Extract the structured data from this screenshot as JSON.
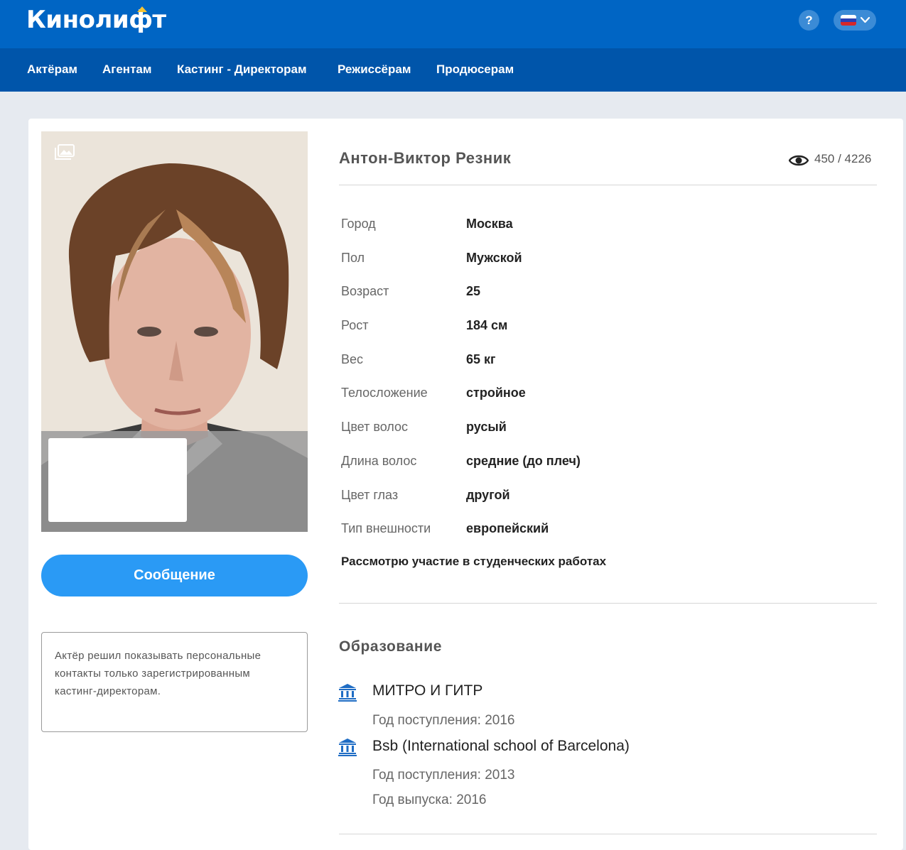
{
  "header": {
    "logo": "Кинолифт",
    "help_label": "?",
    "language": "RU"
  },
  "nav": {
    "items": [
      "Актёрам",
      "Агентам",
      "Кастинг - Директорам",
      "Режиссёрам",
      "Продюсерам"
    ]
  },
  "actions": {
    "message_label": "Сообщение"
  },
  "notice": {
    "text": "Актёр решил показывать персональные контакты только зарегистрированным кастинг-директорам."
  },
  "profile": {
    "name": "Антон-Виктор Резник",
    "views": "450 / 4226",
    "details": [
      {
        "label": "Город",
        "value": "Москва"
      },
      {
        "label": "Пол",
        "value": "Мужской"
      },
      {
        "label": "Возраст",
        "value": "25"
      },
      {
        "label": "Рост",
        "value": "184 см"
      },
      {
        "label": "Вес",
        "value": "65 кг"
      },
      {
        "label": "Телосложение",
        "value": "стройное"
      },
      {
        "label": "Цвет волос",
        "value": "русый"
      },
      {
        "label": "Длина волос",
        "value": "средние (до плеч)"
      },
      {
        "label": "Цвет глаз",
        "value": "другой"
      },
      {
        "label": "Тип внешности",
        "value": "европейский"
      }
    ],
    "student_note": "Рассмотрю участие в студенческих работах"
  },
  "education": {
    "title": "Образование",
    "items": [
      {
        "name": "МИТРО И ГИТР",
        "admission": "Год поступления: 2016",
        "graduation": ""
      },
      {
        "name": "Bsb (International school of Barcelona)",
        "admission": "Год поступления: 2013",
        "graduation": "Год выпуска: 2016"
      }
    ]
  },
  "colors": {
    "header_bg": "#0065c4",
    "nav_bg": "#0055aa",
    "button": "#2a9af5",
    "logo_accent": "#f6c433",
    "icon_blue": "#1e6cc4"
  }
}
